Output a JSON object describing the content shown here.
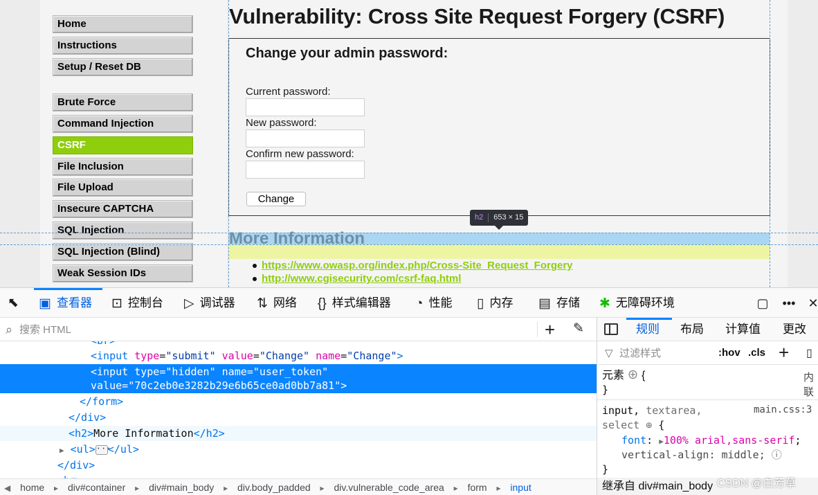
{
  "page": {
    "title": "Vulnerability: Cross Site Request Forgery (CSRF)",
    "menu": [
      {
        "label": "Home"
      },
      {
        "label": "Instructions"
      },
      {
        "label": "Setup / Reset DB"
      },
      {
        "label": "Brute Force"
      },
      {
        "label": "Command Injection"
      },
      {
        "label": "CSRF",
        "selected": true
      },
      {
        "label": "File Inclusion"
      },
      {
        "label": "File Upload"
      },
      {
        "label": "Insecure CAPTCHA"
      },
      {
        "label": "SQL Injection"
      },
      {
        "label": "SQL Injection (Blind)"
      },
      {
        "label": "Weak Session IDs"
      }
    ],
    "form": {
      "heading": "Change your admin password:",
      "current_label": "Current password:",
      "new_label": "New password:",
      "confirm_label": "Confirm new password:",
      "button": "Change"
    },
    "more_info": "More Information",
    "links": [
      "https://www.owasp.org/index.php/Cross-Site_Request_Forgery",
      "http://www.cgisecurity.com/csrf-faq.html"
    ],
    "highlight_tooltip": {
      "tag": "h2",
      "size": "653 × 15"
    }
  },
  "devtools": {
    "tabs": [
      {
        "label": "查看器",
        "icon": "inspector-icon",
        "active": true
      },
      {
        "label": "控制台",
        "icon": "console-icon"
      },
      {
        "label": "调试器",
        "icon": "debugger-icon"
      },
      {
        "label": "网络",
        "icon": "network-icon"
      },
      {
        "label": "样式编辑器",
        "icon": "style-editor-icon"
      },
      {
        "label": "性能",
        "icon": "performance-icon"
      },
      {
        "label": "内存",
        "icon": "memory-icon"
      },
      {
        "label": "存储",
        "icon": "storage-icon"
      },
      {
        "label": "无障碍环境",
        "icon": "accessibility-icon"
      }
    ],
    "search_placeholder": "搜索 HTML",
    "markup": {
      "l1": {
        "tag_open": "<input ",
        "a1": "type",
        "v1": "\"submit\"",
        "a2": "value",
        "v2": "\"Change\"",
        "a3": "name",
        "v3": "\"Change\"",
        "tag_close": ">"
      },
      "l2": {
        "tag_open": "<input ",
        "a1": "type",
        "v1": "\"hidden\"",
        "a2": "name",
        "v2": "\"user_token\""
      },
      "l3": {
        "a1": "value",
        "v1": "\"70c2eb0e3282b29e6b65ce0ad0bb7a81\"",
        "tag_close": ">"
      },
      "l4": "</form>",
      "l5": "</div>",
      "l6": {
        "tag_open": "<h2>",
        "text": "More Information",
        "tag_close": "</h2>"
      },
      "l7": {
        "tag_open": "<ul>",
        "tag_close": "</ul>"
      },
      "l8": "</div>"
    },
    "breadcrumbs": [
      "home",
      "div#container",
      "div#main_body",
      "div.body_padded",
      "div.vulnerable_code_area",
      "form",
      "input"
    ],
    "rules_panel": {
      "tabs": [
        "规则",
        "布局",
        "计算值",
        "更改"
      ],
      "filter_placeholder": "过滤样式",
      "hov": ":hov",
      "cls": ".cls",
      "element_label": "元素",
      "element_open": "{",
      "element_close": "}",
      "inline_label": "内联",
      "rule_selector_1": "input, ",
      "rule_selector_2": "textarea,",
      "rule_selector_3": "select",
      "rule_source": "main.css:3",
      "prop1": "font",
      "val1": "100% arial,sans-serif",
      "prop2": "vertical-align",
      "val2": "middle",
      "inherited": "继承自 div#main_body"
    }
  },
  "watermark": "CSDN @白芳草"
}
